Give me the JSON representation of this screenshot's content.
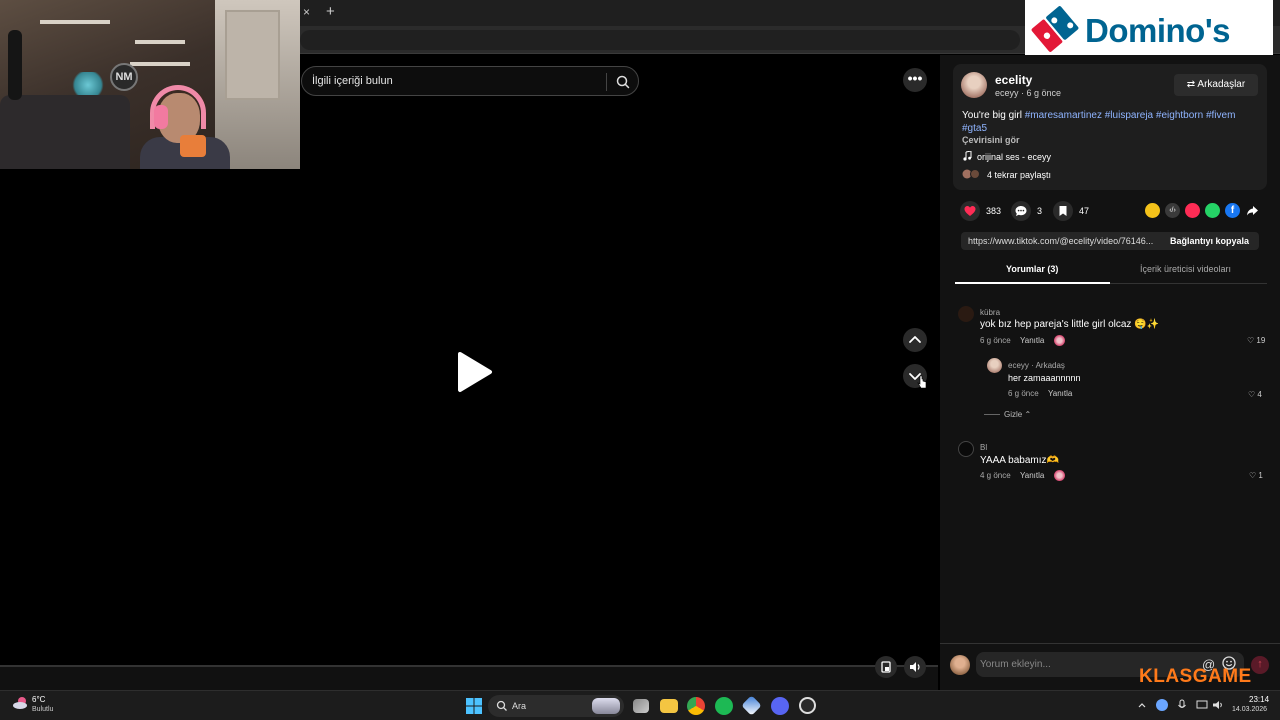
{
  "browser": {
    "close_tab_glyph": "×",
    "new_tab_glyph": "+"
  },
  "webcam": {
    "logo_text": "NM"
  },
  "ad": {
    "brand": "Domino's",
    "colors": {
      "blue": "#006491",
      "red": "#e31837"
    }
  },
  "video": {
    "search_placeholder": "İlgili içeriği bulun",
    "more_glyph": "•••",
    "icons": [
      "search-icon",
      "play-icon",
      "chevron-up-icon",
      "chevron-down-icon",
      "miniplayer-icon",
      "volume-icon"
    ]
  },
  "post": {
    "username": "ecelity",
    "subline": "eceyy · 6 g önce",
    "friends_label": "⇄ Arkadaşlar",
    "caption_text": "You're big girl ",
    "hashtags": [
      "#maresamartinez",
      "#luispareja",
      "#eightborn",
      "#fivem",
      "#gta5"
    ],
    "translate": "Çevirisini gör",
    "sound": "orijinal ses - eceyy",
    "reposts": "4 tekrar paylaştı"
  },
  "stats": {
    "likes": "383",
    "comments": "3",
    "saves": "47"
  },
  "share_icons": [
    {
      "name": "coin-share-icon",
      "color": "#f4c21a"
    },
    {
      "name": "embed-icon",
      "color": "#3a3a3a"
    },
    {
      "name": "send-to-friends-icon",
      "color": "#fe2c55"
    },
    {
      "name": "whatsapp-icon",
      "color": "#25d366"
    },
    {
      "name": "facebook-icon",
      "color": "#1877f2"
    },
    {
      "name": "forward-icon",
      "color": "#121212"
    }
  ],
  "link": {
    "url": "https://www.tiktok.com/@ecelity/video/76146...",
    "copy_label": "Bağlantıyı kopyala"
  },
  "tabs": {
    "comments": "Yorumlar (3)",
    "creator_videos": "İçerik üreticisi videoları"
  },
  "comments": [
    {
      "name": "kübra",
      "text": "yok bız hep pareja's little girl olcaz 🤤✨",
      "time": "6 g önce",
      "reply": "Yanıtla",
      "likes": "19"
    },
    {
      "name": "eceyy · Arkadaş",
      "text": "her zamaaannnnn",
      "time": "6 g önce",
      "reply": "Yanıtla",
      "likes": "4"
    },
    {
      "name": "Bl",
      "text": "YAAA babamız🫶",
      "time": "4 g önce",
      "reply": "Yanıtla",
      "likes": "1"
    }
  ],
  "hide_replies": "Gizle ⌃",
  "comment_bar": {
    "placeholder": "Yorum ekleyin...",
    "at": "@",
    "send_glyph": "↑"
  },
  "watermark": "KLASGAME",
  "taskbar": {
    "weather_temp": "6°C",
    "weather_desc": "Bulutlu",
    "search_label": "Ara",
    "time": "23:14",
    "date": "14.03.2026"
  }
}
